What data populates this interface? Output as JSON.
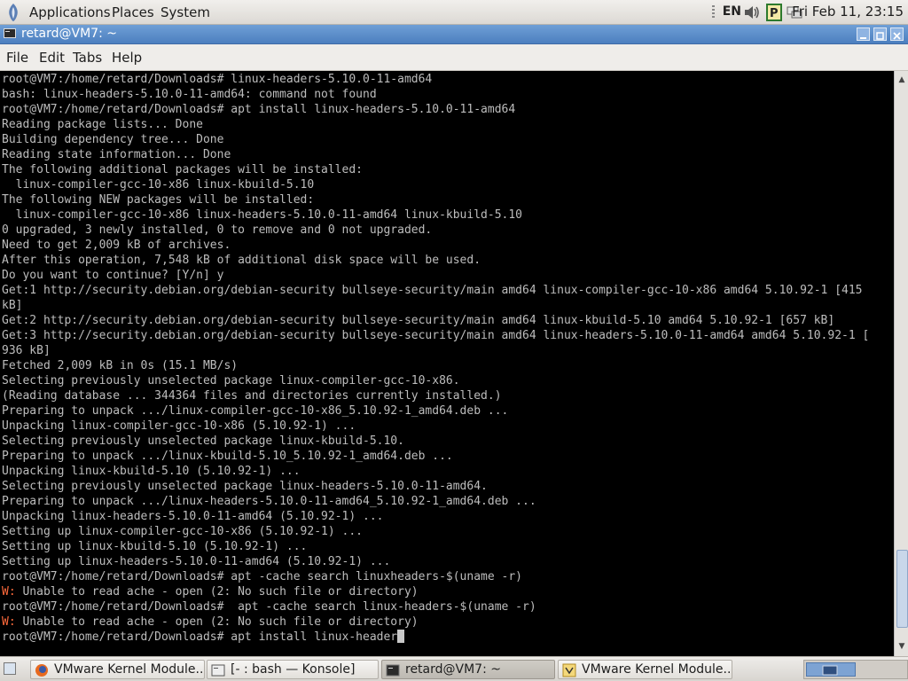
{
  "top_panel": {
    "menus": [
      "Applications",
      "Places",
      "System"
    ],
    "keyboard_layout": "EN",
    "clock": "Fri Feb 11, 23:15"
  },
  "window": {
    "title": "retard@VM7: ~"
  },
  "menubar": [
    "File",
    "Edit",
    "Tabs",
    "Help"
  ],
  "terminal": {
    "lines": [
      "root@VM7:/home/retard/Downloads# linux-headers-5.10.0-11-amd64",
      "bash: linux-headers-5.10.0-11-amd64: command not found",
      "root@VM7:/home/retard/Downloads# apt install linux-headers-5.10.0-11-amd64",
      "Reading package lists... Done",
      "Building dependency tree... Done",
      "Reading state information... Done",
      "The following additional packages will be installed:",
      "  linux-compiler-gcc-10-x86 linux-kbuild-5.10",
      "The following NEW packages will be installed:",
      "  linux-compiler-gcc-10-x86 linux-headers-5.10.0-11-amd64 linux-kbuild-5.10",
      "0 upgraded, 3 newly installed, 0 to remove and 0 not upgraded.",
      "Need to get 2,009 kB of archives.",
      "After this operation, 7,548 kB of additional disk space will be used.",
      "Do you want to continue? [Y/n] y",
      "Get:1 http://security.debian.org/debian-security bullseye-security/main amd64 linux-compiler-gcc-10-x86 amd64 5.10.92-1 [415",
      "kB]",
      "Get:2 http://security.debian.org/debian-security bullseye-security/main amd64 linux-kbuild-5.10 amd64 5.10.92-1 [657 kB]",
      "Get:3 http://security.debian.org/debian-security bullseye-security/main amd64 linux-headers-5.10.0-11-amd64 amd64 5.10.92-1 [",
      "936 kB]",
      "Fetched 2,009 kB in 0s (15.1 MB/s)",
      "Selecting previously unselected package linux-compiler-gcc-10-x86.",
      "(Reading database ... 344364 files and directories currently installed.)",
      "Preparing to unpack .../linux-compiler-gcc-10-x86_5.10.92-1_amd64.deb ...",
      "Unpacking linux-compiler-gcc-10-x86 (5.10.92-1) ...",
      "Selecting previously unselected package linux-kbuild-5.10.",
      "Preparing to unpack .../linux-kbuild-5.10_5.10.92-1_amd64.deb ...",
      "Unpacking linux-kbuild-5.10 (5.10.92-1) ...",
      "Selecting previously unselected package linux-headers-5.10.0-11-amd64.",
      "Preparing to unpack .../linux-headers-5.10.0-11-amd64_5.10.92-1_amd64.deb ...",
      "Unpacking linux-headers-5.10.0-11-amd64 (5.10.92-1) ...",
      "Setting up linux-compiler-gcc-10-x86 (5.10.92-1) ...",
      "Setting up linux-kbuild-5.10 (5.10.92-1) ...",
      "Setting up linux-headers-5.10.0-11-amd64 (5.10.92-1) ...",
      "root@VM7:/home/retard/Downloads# apt -cache search linuxheaders-$(uname -r)",
      {
        "prefix": "W:",
        "text": " Unable to read ache - open (2: No such file or directory)"
      },
      "root@VM7:/home/retard/Downloads#  apt -cache search linux-headers-$(uname -r)",
      {
        "prefix": "W:",
        "text": " Unable to read ache - open (2: No such file or directory)"
      },
      {
        "text": "root@VM7:/home/retard/Downloads# apt install linux-header",
        "cursor": true
      }
    ]
  },
  "taskbar": {
    "tasks": [
      {
        "icon": "firefox-icon",
        "label": "VMware Kernel Module...",
        "active": false
      },
      {
        "icon": "konsole-icon",
        "label": "[- : bash — Konsole]",
        "active": false
      },
      {
        "icon": "terminal-icon",
        "label": "retard@VM7: ~",
        "active": true
      },
      {
        "icon": "vmware-icon",
        "label": "VMware Kernel Module...",
        "active": false
      }
    ]
  },
  "colors": {
    "terminal_bg": "#000000",
    "terminal_fg": "#bdbdbd",
    "warning": "#ff6a3c",
    "titlebar": "#5a8bc8"
  }
}
